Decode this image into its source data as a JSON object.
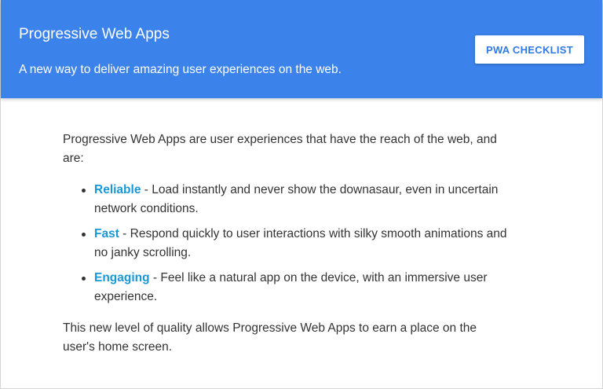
{
  "header": {
    "title": "Progressive Web Apps",
    "subtitle": "A new way to deliver amazing user experiences on the web.",
    "checklist_button": "PWA CHECKLIST"
  },
  "content": {
    "intro": "Progressive Web Apps are user experiences that have the reach of the web, and are:",
    "features": [
      {
        "name": "Reliable",
        "separator": " - ",
        "description": "Load instantly and never show the downasaur, even in uncertain network conditions."
      },
      {
        "name": "Fast",
        "separator": " - ",
        "description": "Respond quickly to user interactions with silky smooth animations and no janky scrolling."
      },
      {
        "name": "Engaging",
        "separator": " - ",
        "description": "Feel like a natural app on the device, with an immersive user experience."
      }
    ],
    "outro": "This new level of quality allows Progressive Web Apps to earn a place on the user's home screen."
  },
  "colors": {
    "header_bg": "#3b82ea",
    "link": "#1a98d5",
    "body_text": "#333333"
  }
}
